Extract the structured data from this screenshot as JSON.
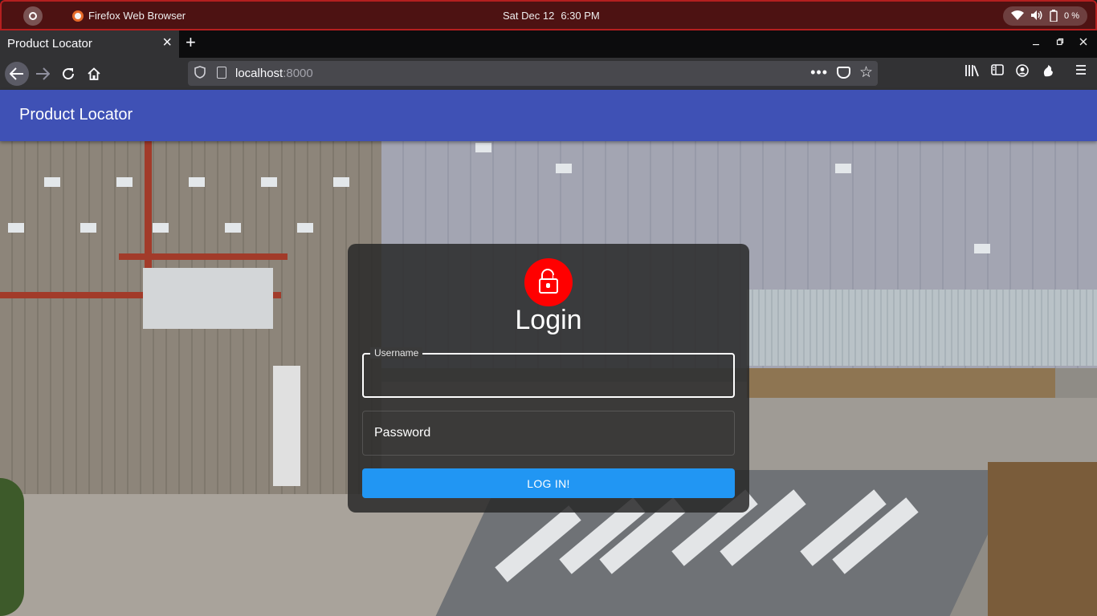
{
  "system_bar": {
    "app_name": "Firefox Web Browser",
    "date": "Sat Dec 12",
    "time": "6:30 PM",
    "battery": "0 %"
  },
  "browser": {
    "tab_title": "Product Locator",
    "tab_close": "×",
    "new_tab": "+",
    "url_host": "localhost",
    "url_port": ":8000",
    "url_more": "•••"
  },
  "app": {
    "title": "Product Locator"
  },
  "login": {
    "heading": "Login",
    "username_label": "Username",
    "username_value": "",
    "password_placeholder": "Password",
    "submit_label": "LOG IN!"
  },
  "colors": {
    "app_bar": "#3f51b5",
    "lock_circle": "#ff0000",
    "login_button": "#2196f3",
    "system_bar": "#4d1212"
  },
  "icons": [
    "activities-icon",
    "firefox-icon",
    "wifi-icon",
    "volume-icon",
    "battery-icon",
    "back-icon",
    "forward-icon",
    "reload-icon",
    "home-icon",
    "shield-icon",
    "page-icon",
    "pocket-icon",
    "star-icon",
    "library-icon",
    "sidebar-icon",
    "account-icon",
    "extension-icon",
    "menu-icon",
    "lock-open-icon"
  ]
}
